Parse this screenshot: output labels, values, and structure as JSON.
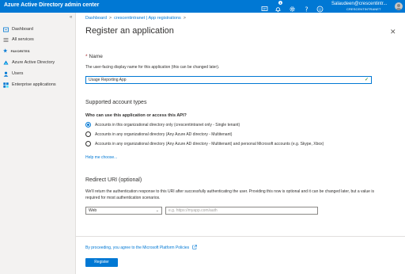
{
  "topbar": {
    "title": "Azure Active Directory admin center",
    "notification_count": "1",
    "user_name": "Salaudeen@crescentintr...",
    "user_tenant": "CRESCENTINTRANET",
    "icons": [
      "feedback-icon",
      "bell-icon",
      "gear-icon",
      "help-icon",
      "smiley-icon"
    ]
  },
  "sidebar": {
    "collapse_glyph": "«",
    "items": [
      {
        "label": "Dashboard",
        "icon": "dashboard-icon"
      },
      {
        "label": "All services",
        "icon": "list-icon"
      },
      {
        "label": "Azure Active Directory",
        "icon": "aad-icon"
      },
      {
        "label": "Users",
        "icon": "user-icon"
      },
      {
        "label": "Enterprise applications",
        "icon": "apps-icon"
      }
    ],
    "favorites_label": "FAVORITES"
  },
  "breadcrumb": [
    "Dashboard",
    "crescentintranet | App registrations"
  ],
  "page_title": "Register an application",
  "name_section": {
    "label": "Name",
    "description": "The user-facing display name for this application (this can be changed later).",
    "value": "Usage Reporting App"
  },
  "account_types": {
    "title": "Supported account types",
    "question": "Who can use this application or access this API?",
    "options": [
      "Accounts in this organizational directory only (crescentintranet only - Single tenant)",
      "Accounts in any organizational directory (Any Azure AD directory - Multitenant)",
      "Accounts in any organizational directory (Any Azure AD directory - Multitenant) and personal Microsoft accounts (e.g. Skype, Xbox)"
    ],
    "selected_index": 0,
    "help_link": "Help me choose..."
  },
  "redirect": {
    "title": "Redirect URI (optional)",
    "description": "We'll return the authentication response to this URI after successfully authenticating the user. Providing this now is optional and it can be changed later, but a value is required for most authentication scenarios.",
    "platform": "Web",
    "url_placeholder": "e.g. https://myapp.com/auth"
  },
  "footer": {
    "policy_text": "By proceeding, you agree to the Microsoft Platform Policies",
    "register_label": "Register"
  },
  "colors": {
    "accent": "#0078d4",
    "required": "#a4262c",
    "valid": "#107c10"
  }
}
